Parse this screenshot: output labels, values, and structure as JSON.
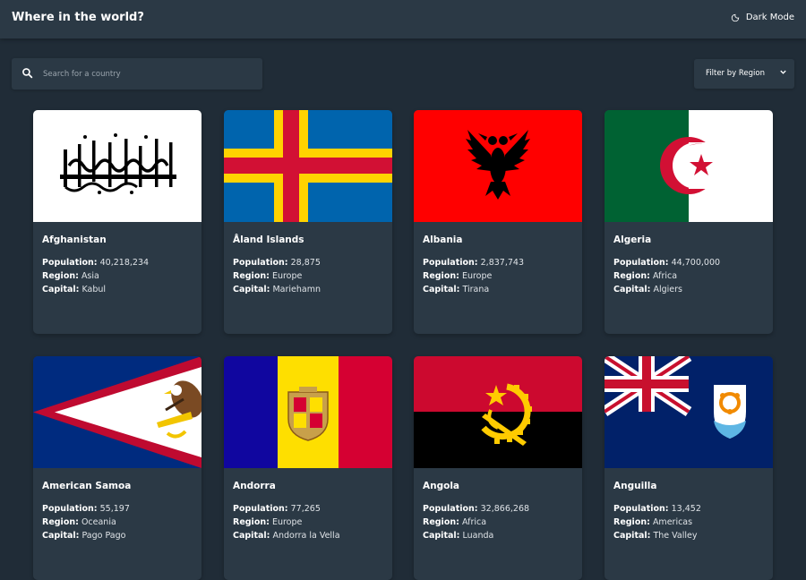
{
  "header": {
    "title": "Where in the world?",
    "mode_label": "Dark Mode"
  },
  "search": {
    "placeholder": "Search for a country"
  },
  "filter": {
    "label": "Filter by Region"
  },
  "labels": {
    "population": "Population:",
    "region": "Region:",
    "capital": "Capital:"
  },
  "countries": [
    {
      "name": "Afghanistan",
      "population": "40,218,234",
      "region": "Asia",
      "capital": "Kabul"
    },
    {
      "name": "Åland Islands",
      "population": "28,875",
      "region": "Europe",
      "capital": "Mariehamn"
    },
    {
      "name": "Albania",
      "population": "2,837,743",
      "region": "Europe",
      "capital": "Tirana"
    },
    {
      "name": "Algeria",
      "population": "44,700,000",
      "region": "Africa",
      "capital": "Algiers"
    },
    {
      "name": "American Samoa",
      "population": "55,197",
      "region": "Oceania",
      "capital": "Pago Pago"
    },
    {
      "name": "Andorra",
      "population": "77,265",
      "region": "Europe",
      "capital": "Andorra la Vella"
    },
    {
      "name": "Angola",
      "population": "32,866,268",
      "region": "Africa",
      "capital": "Luanda"
    },
    {
      "name": "Anguilla",
      "population": "13,452",
      "region": "Americas",
      "capital": "The Valley"
    }
  ],
  "colors": {
    "background": "#202c37",
    "surface": "#2b3945",
    "text": "#ffffff"
  }
}
